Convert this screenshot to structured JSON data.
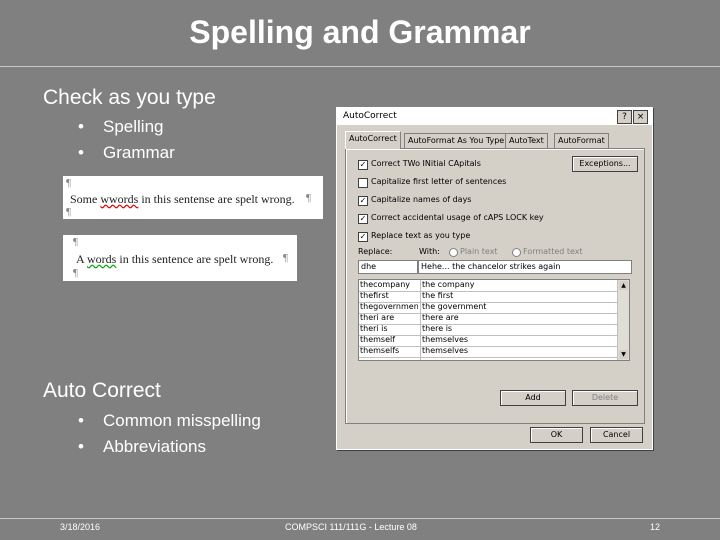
{
  "slide": {
    "title": "Spelling and Grammar",
    "section1": "Check as you type",
    "bullets1": [
      "Spelling",
      "Grammar"
    ],
    "section2": "Auto Correct",
    "bullets2": [
      "Common misspelling",
      "Abbreviations"
    ]
  },
  "snippet1": {
    "pilcrow": "¶",
    "before": "Some ",
    "misspelled": "wwords",
    "middle": " in this sentense are spelt ",
    "tail": "wrong.",
    "end": "¶"
  },
  "snippet2": {
    "pilcrow": "¶",
    "before": "A ",
    "grammar": "words",
    "rest": " in this sentence are spelt wrong.",
    "end": "¶"
  },
  "dialog": {
    "title": "AutoCorrect",
    "help": "?",
    "close": "×",
    "tabs": [
      "AutoCorrect",
      "AutoFormat As You Type",
      "AutoText",
      "AutoFormat"
    ],
    "exceptions_label": "Exceptions...",
    "options": [
      {
        "label": "Correct TWo INitial CApitals",
        "checked": true
      },
      {
        "label": "Capitalize first letter of sentences",
        "checked": false
      },
      {
        "label": "Capitalize names of days",
        "checked": true
      },
      {
        "label": "Correct accidental usage of cAPS LOCK key",
        "checked": true
      },
      {
        "label": "Replace text as you type",
        "checked": true
      }
    ],
    "replace_label": "Replace:",
    "with_label": "With:",
    "plain_text": "Plain text",
    "formatted_text": "Formatted text",
    "replace_value": "dhe",
    "with_value": "Hehe... the chancelor strikes again",
    "rows": [
      {
        "from": "thecompany",
        "to": "the company"
      },
      {
        "from": "thefirst",
        "to": "the first"
      },
      {
        "from": "thegovernment",
        "to": "the government"
      },
      {
        "from": "theri are",
        "to": "there are"
      },
      {
        "from": "theri is",
        "to": "there is"
      },
      {
        "from": "themself",
        "to": "themselves"
      },
      {
        "from": "themselfs",
        "to": "themselves"
      }
    ],
    "add_label": "Add",
    "delete_label": "Delete",
    "ok_label": "OK",
    "cancel_label": "Cancel"
  },
  "footer": {
    "date": "3/18/2016",
    "course": "COMPSCI 111/111G - Lecture 08",
    "page": "12"
  }
}
